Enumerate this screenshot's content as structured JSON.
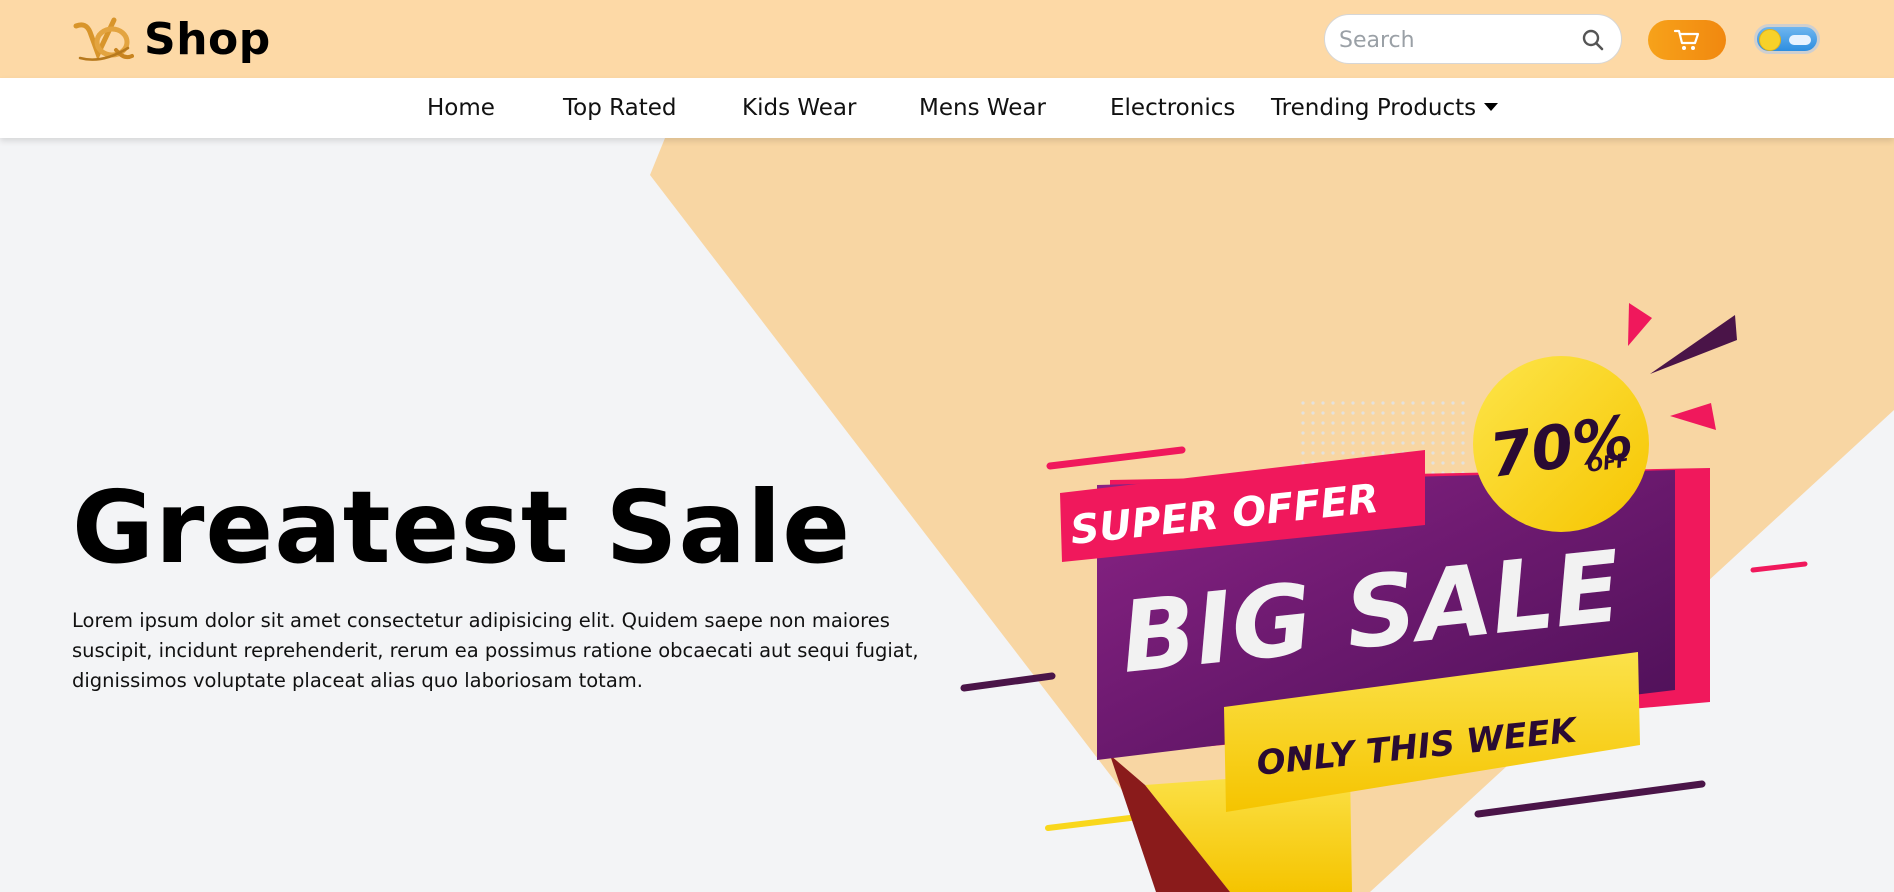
{
  "header": {
    "brand_mark": "VQ",
    "brand_name": "Shop",
    "search_placeholder": "Search"
  },
  "nav": {
    "items": [
      {
        "label": "Home"
      },
      {
        "label": "Top Rated"
      },
      {
        "label": "Kids Wear"
      },
      {
        "label": "Mens Wear"
      },
      {
        "label": "Electronics"
      },
      {
        "label": "Trending Products",
        "has_dropdown": true
      }
    ]
  },
  "hero": {
    "title": "Greatest Sale",
    "description": "Lorem ipsum dolor sit amet consectetur adipisicing elit. Quidem saepe non maiores suscipit, incidunt reprehenderit, rerum ea possimus ratione obcaecati aut sequi fugiat, dignissimos voluptate placeat alias quo laboriosam totam.",
    "banner": {
      "tag": "SUPER OFFER",
      "headline": "BIG SALE",
      "subline": "ONLY THIS WEEK",
      "discount": "70%",
      "discount_suffix": "OFF"
    }
  },
  "colors": {
    "header_bg": "#fdd9a6",
    "accent": "#f39c12",
    "hero_shape": "#f8d6a3",
    "banner_pink": "#f0185c",
    "banner_purple": "#6b1a6f",
    "banner_yellow": "#f9d71c"
  },
  "icons": {
    "logo": "vq-logo",
    "search": "search-icon",
    "cart": "cart-icon",
    "theme": "theme-toggle"
  }
}
